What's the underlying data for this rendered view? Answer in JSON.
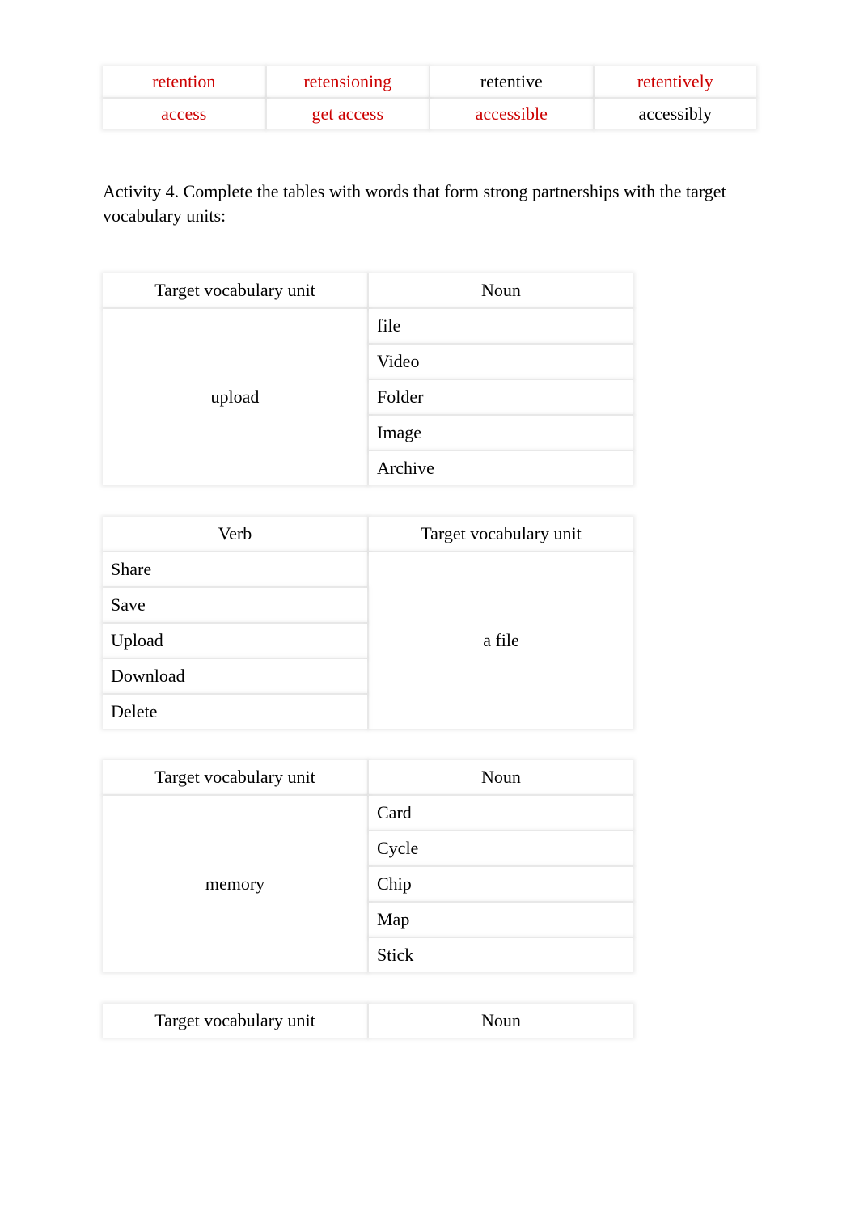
{
  "topTable": {
    "rows": [
      [
        {
          "text": "retention",
          "red": true
        },
        {
          "text": "retensioning",
          "red": true
        },
        {
          "text": "retentive",
          "red": false
        },
        {
          "text": "retentively",
          "red": true
        }
      ],
      [
        {
          "text": "access",
          "red": true
        },
        {
          "text": "get access",
          "red": true
        },
        {
          "text": "accessible",
          "red": true
        },
        {
          "text": "accessibly",
          "red": false
        }
      ]
    ]
  },
  "activityText": "Activity 4. Complete the tables with words that form strong partnerships with the target vocabulary units:",
  "table1": {
    "headerLeft": "Target vocabulary unit",
    "headerRight": "Noun",
    "leftCell": "upload",
    "rightCells": [
      "file",
      "Video",
      "Folder",
      "Image",
      "Archive"
    ]
  },
  "table2": {
    "headerLeft": "Verb",
    "headerRight": "Target vocabulary unit",
    "leftCells": [
      "Share",
      "Save",
      "Upload",
      "Download",
      "Delete"
    ],
    "rightCell": "a file"
  },
  "table3": {
    "headerLeft": "Target vocabulary unit",
    "headerRight": "Noun",
    "leftCell": "memory",
    "rightCells": [
      "Card",
      "Cycle",
      "Chip",
      "Map",
      "Stick"
    ]
  },
  "table4": {
    "headerLeft": "Target vocabulary unit",
    "headerRight": "Noun"
  }
}
